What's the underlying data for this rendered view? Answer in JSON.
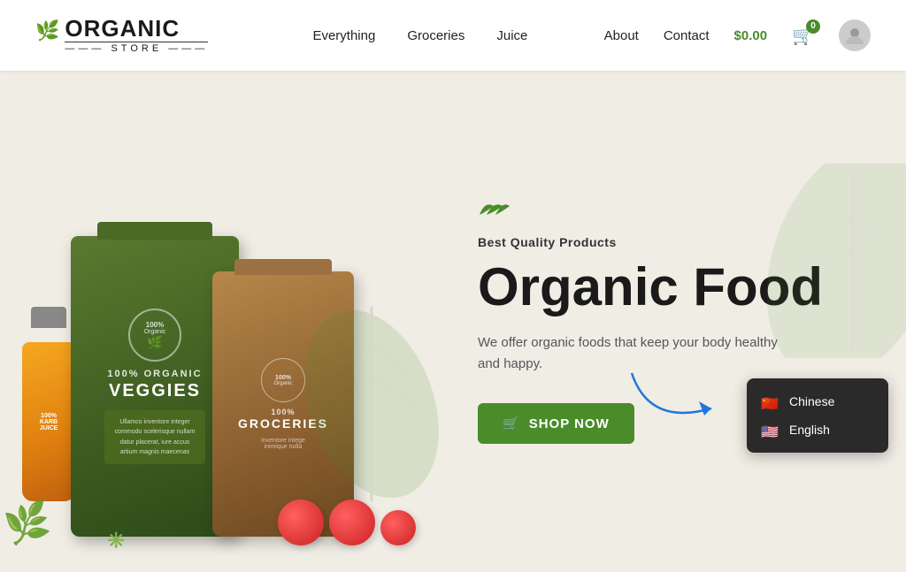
{
  "header": {
    "logo": {
      "organic": "ORGANIC",
      "store": "——— STORE ———"
    },
    "nav_left": [
      {
        "label": "Everything",
        "href": "#"
      },
      {
        "label": "Groceries",
        "href": "#"
      },
      {
        "label": "Juice",
        "href": "#"
      }
    ],
    "nav_right": [
      {
        "label": "About",
        "href": "#"
      },
      {
        "label": "Contact",
        "href": "#"
      }
    ],
    "cart_price": "$0.00",
    "cart_count": "0"
  },
  "hero": {
    "tag_icon": "🌿",
    "subtitle": "Best Quality Products",
    "title": "Organic Food",
    "description": "We offer organic foods that keep your body healthy and happy.",
    "shop_btn": "SHOP NOW",
    "shop_icon": "🛒"
  },
  "products": [
    {
      "name": "VEGGIES",
      "subtitle": "100% Organic",
      "color": "green"
    },
    {
      "name": "GROCERIES",
      "subtitle": "100% Organic",
      "color": "brown"
    }
  ],
  "language_dropdown": {
    "items": [
      {
        "label": "Chinese",
        "flag": "🇨🇳"
      },
      {
        "label": "English",
        "flag": "🇺🇸"
      }
    ]
  }
}
